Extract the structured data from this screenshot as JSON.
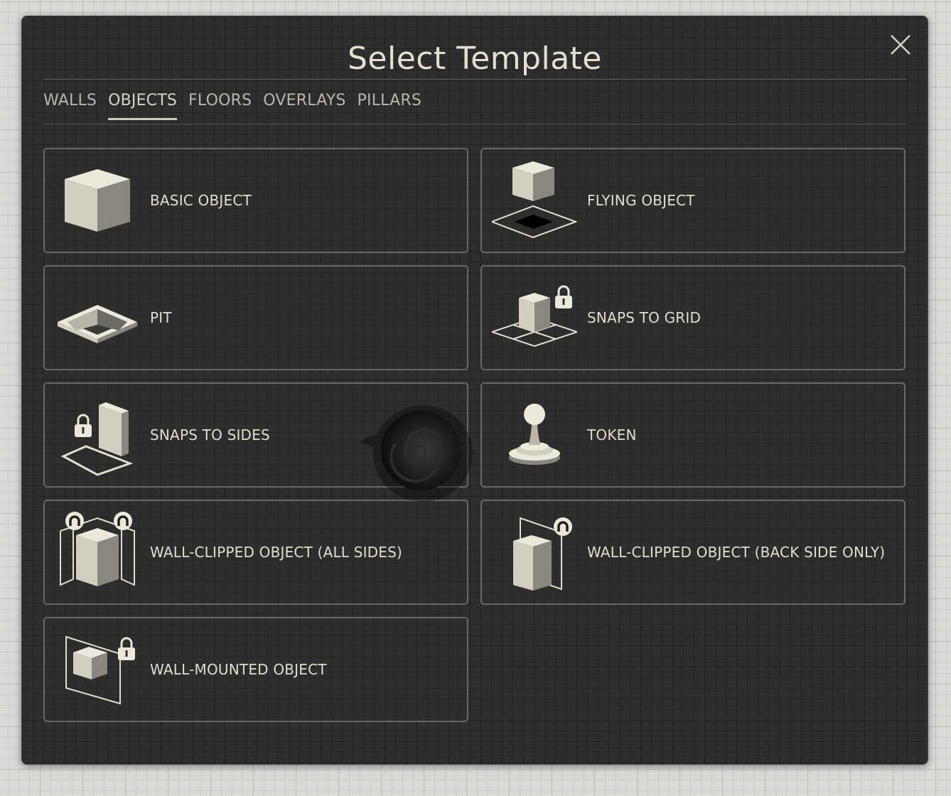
{
  "dialog": {
    "title": "Select Template",
    "close_icon": "close-icon"
  },
  "tabs": [
    {
      "label": "WALLS",
      "active": false
    },
    {
      "label": "OBJECTS",
      "active": true
    },
    {
      "label": "FLOORS",
      "active": false
    },
    {
      "label": "OVERLAYS",
      "active": false
    },
    {
      "label": "PILLARS",
      "active": false
    }
  ],
  "templates": [
    {
      "label": "BASIC OBJECT",
      "icon": "basic-object-icon"
    },
    {
      "label": "FLYING OBJECT",
      "icon": "flying-object-icon"
    },
    {
      "label": "PIT",
      "icon": "pit-icon"
    },
    {
      "label": "SNAPS TO GRID",
      "icon": "snaps-to-grid-icon"
    },
    {
      "label": "SNAPS TO SIDES",
      "icon": "snaps-to-sides-icon"
    },
    {
      "label": "TOKEN",
      "icon": "token-icon"
    },
    {
      "label": "WALL-CLIPPED OBJECT (ALL SIDES)",
      "icon": "wall-clipped-all-sides-icon"
    },
    {
      "label": "WALL-CLIPPED OBJECT (BACK SIDE ONLY)",
      "icon": "wall-clipped-back-side-icon"
    },
    {
      "label": "WALL-MOUNTED OBJECT",
      "icon": "wall-mounted-object-icon"
    }
  ],
  "colors": {
    "panel": "#2e2e2e",
    "text": "#e0dccf",
    "card_border": "#686865",
    "icon_light": "#d8d4c6",
    "icon_dark": "#8a8780"
  }
}
